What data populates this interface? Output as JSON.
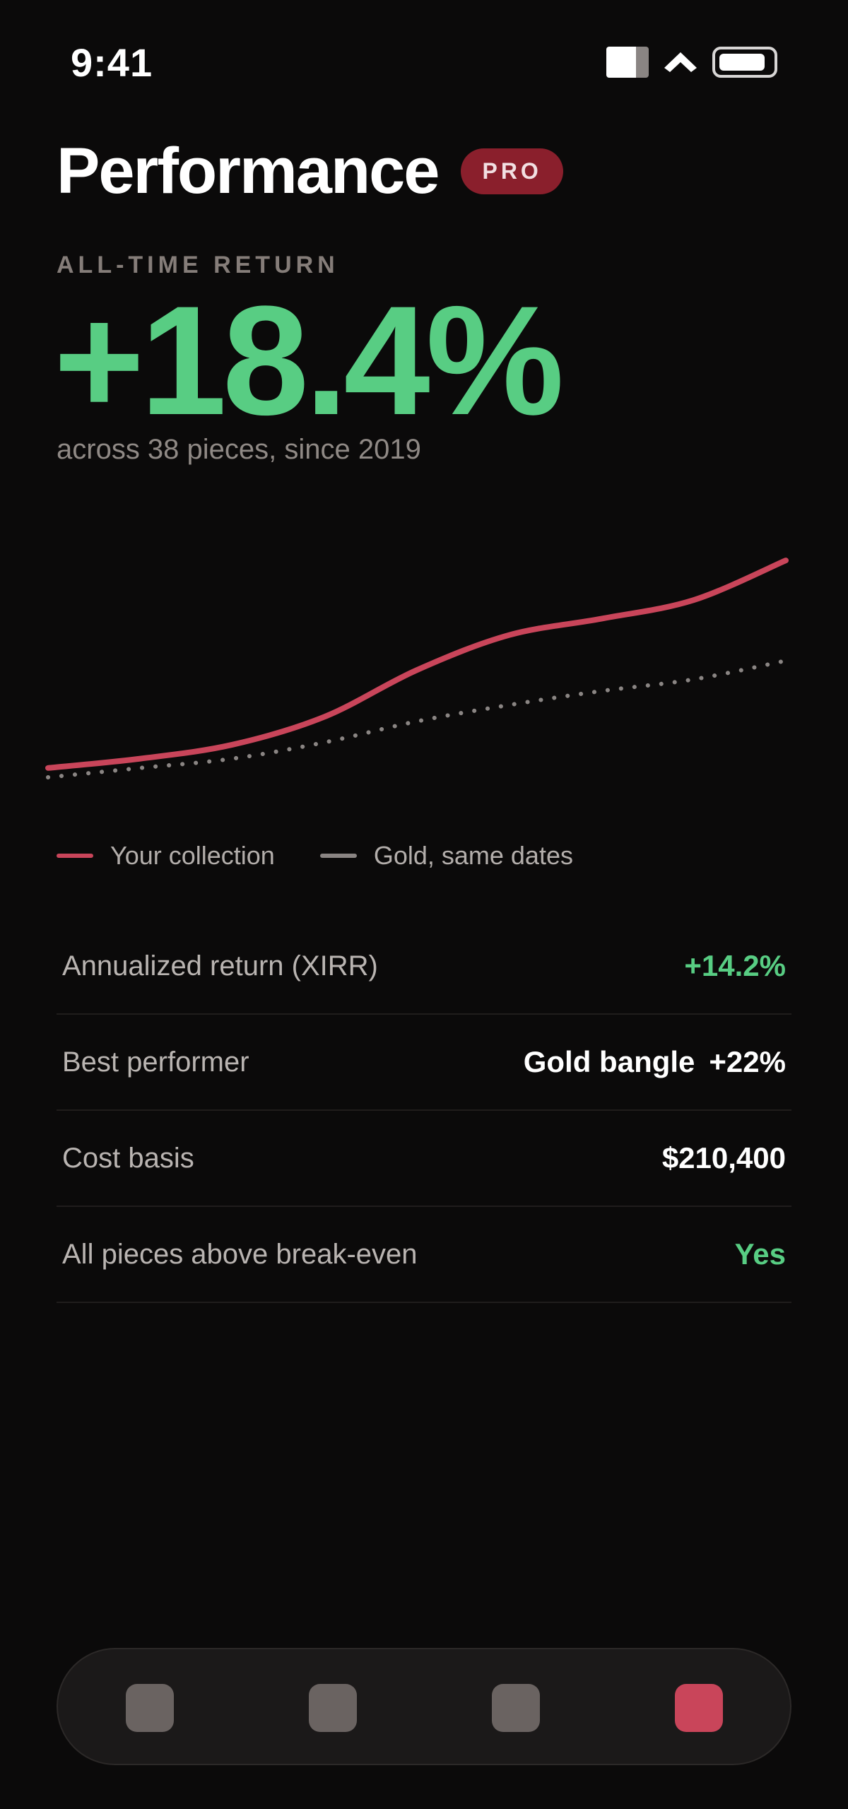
{
  "status": {
    "time": "9:41"
  },
  "header": {
    "title": "Performance",
    "badge": "PRO"
  },
  "summary": {
    "eyebrow": "ALL-TIME RETURN",
    "value": "+18.4%",
    "subtitle": "across 38 pieces, since 2019"
  },
  "chart_data": {
    "type": "line",
    "series": [
      {
        "name": "Your collection",
        "color": "#c9455a",
        "style": "solid",
        "values": [
          0.04,
          0.08,
          0.14,
          0.26,
          0.46,
          0.61,
          0.68,
          0.76,
          0.93
        ]
      },
      {
        "name": "Gold, same dates",
        "color": "#8a8583",
        "style": "dotted",
        "values": [
          0.0,
          0.04,
          0.08,
          0.15,
          0.24,
          0.31,
          0.37,
          0.42,
          0.5
        ]
      }
    ],
    "ylim": [
      0,
      1
    ],
    "grid": false,
    "legend": "bottom-left"
  },
  "stats": [
    {
      "label": "Annualized return (XIRR)",
      "value": "+14.2%",
      "tone": "green"
    },
    {
      "label": "Best performer",
      "value_name": "Gold bangle",
      "value": "+22%",
      "tone": "white"
    },
    {
      "label": "Cost basis",
      "value": "$210,400",
      "tone": "white"
    },
    {
      "label": "All pieces above break-even",
      "value": "Yes",
      "tone": "green"
    }
  ],
  "tabbar": {
    "active_index": 3,
    "active_color": "#c9455a",
    "inactive_color": "#6a6361"
  }
}
